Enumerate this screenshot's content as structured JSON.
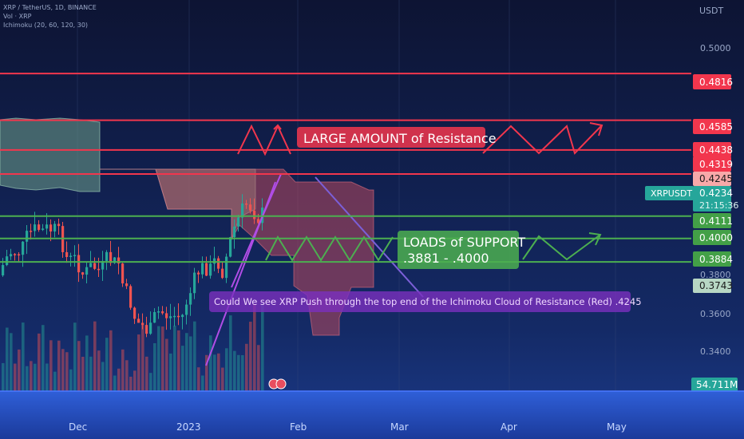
{
  "header": {
    "symbol_line": "XRP / TetherUS, 1D, BINANCE",
    "volume_line": "Vol · XRP",
    "ichimoku_line": "Ichimoku (20, 60, 120, 30)",
    "currency": "USDT"
  },
  "colors": {
    "background_top": "#0d1433",
    "background_bottom": "#1b3a8a",
    "resistance": "#f2364d",
    "support": "#4caf50",
    "cloud_green": "#6fa08a",
    "cloud_red": "#b8485d",
    "candle_up": "#26a69a",
    "candle_down": "#ef5350",
    "annotation_purple": "#7b2fbe",
    "price_tag_teal": "#26a69a"
  },
  "chart_data": {
    "type": "candlestick",
    "x_ticks": [
      "Dec",
      "2023",
      "Feb",
      "Mar",
      "Apr",
      "May"
    ],
    "y_ticks": [
      "0.5000",
      "0.3800",
      "0.3600",
      "0.3400"
    ],
    "ylim": [
      0.3245,
      0.518
    ],
    "resistance_levels": [
      0.4816,
      0.4585,
      0.4438,
      0.4319
    ],
    "support_levels": [
      0.4111,
      0.4,
      0.3884
    ],
    "price_tags": {
      "r1": "0.4816",
      "r2": "0.4585",
      "r3": "0.4438",
      "r4": "0.4319",
      "ichimoku_top": "0.4245",
      "last_symbol": "XRPUSDT",
      "last_price": "0.4234",
      "countdown": "21:15:36",
      "s1": "0.4111",
      "s2": "0.4000",
      "s3": "0.3884",
      "cloud_low": "0.3743",
      "volume": "54.711M"
    },
    "annotations": {
      "resistance": "LARGE AMOUNT of Resistance",
      "support_line1": "LOADS of SUPPORT",
      "support_line2": ".3881 - .4000",
      "question": "Could We see XRP Push through the top end of the Ichimoku Cloud of Resistance (Red) .4245"
    }
  }
}
